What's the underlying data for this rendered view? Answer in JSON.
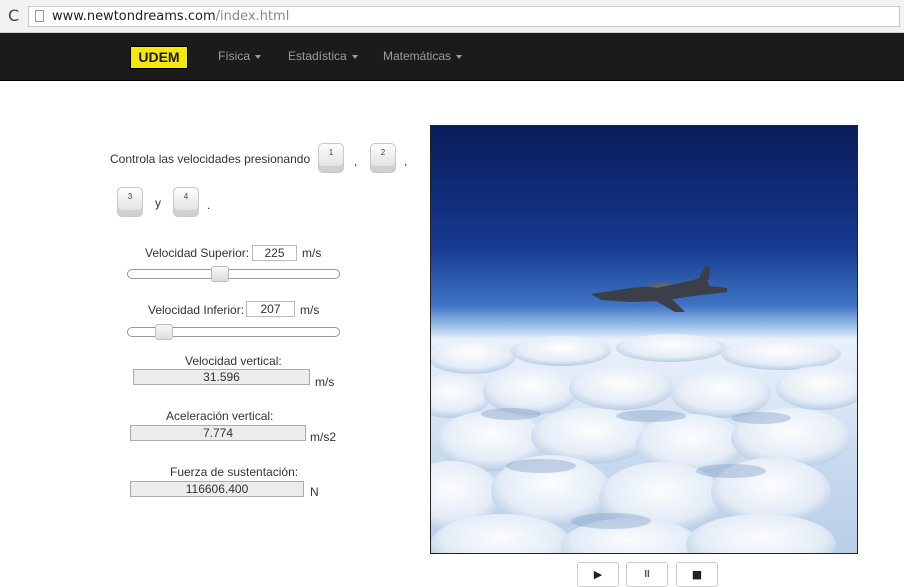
{
  "browser": {
    "url_host": "www.newtondreams.com",
    "url_path": "/index.html"
  },
  "navbar": {
    "brand": "UDEM",
    "menus": [
      "Física",
      "Estadística",
      "Matemáticas"
    ]
  },
  "instructions": {
    "text": "Controla las velocidades presionando",
    "keys": [
      "1",
      "2",
      "3",
      "4"
    ],
    "sep1": ",",
    "sep2": ",",
    "and": "y",
    "end": "."
  },
  "upper": {
    "label": "Velocidad Superior:",
    "value": "225",
    "unit": "m/s",
    "slider_fraction": 0.43
  },
  "lower": {
    "label": "Velocidad Inferior:",
    "value": "207",
    "unit": "m/s",
    "slider_fraction": 0.14
  },
  "vertical_velocity": {
    "label": "Velocidad vertical:",
    "value": "31.596",
    "unit": "m/s"
  },
  "vertical_acceleration": {
    "label": "Aceleración vertical:",
    "value": "7.774",
    "unit": "m/s2"
  },
  "lift_force": {
    "label": "Fuerza de sustentación:",
    "value": "116606.400",
    "unit": "N"
  },
  "controls": {
    "play": "▶",
    "pause": "II",
    "stop": "■"
  },
  "colors": {
    "navbar": "#1b1b1b",
    "brand_bg": "#f7e80c"
  }
}
